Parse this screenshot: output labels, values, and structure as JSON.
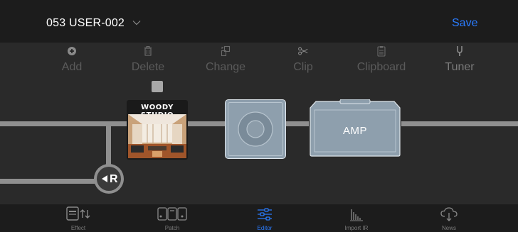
{
  "header": {
    "patch_name": "053 USER-002",
    "save_label": "Save",
    "dropdown_icon": "chevron-down-icon"
  },
  "toolbar": {
    "items": [
      {
        "label": "Add",
        "icon": "add-icon"
      },
      {
        "label": "Delete",
        "icon": "trash-icon"
      },
      {
        "label": "Change",
        "icon": "change-icon"
      },
      {
        "label": "Clip",
        "icon": "scissors-icon"
      },
      {
        "label": "Clipboard",
        "icon": "clipboard-icon"
      },
      {
        "label": "Tuner",
        "icon": "tuning-fork-icon"
      }
    ]
  },
  "chain": {
    "effect_block_title": "WOODY STUDIO",
    "amp_label": "AMP",
    "return_letter": "R"
  },
  "tabbar": {
    "active": "Editor",
    "tabs": [
      {
        "label": "Effect",
        "icon": "effect-icon"
      },
      {
        "label": "Patch",
        "icon": "patch-icon"
      },
      {
        "label": "Editor",
        "icon": "sliders-icon"
      },
      {
        "label": "Import IR",
        "icon": "import-ir-icon"
      },
      {
        "label": "News",
        "icon": "cloud-download-icon"
      }
    ]
  },
  "colors": {
    "accent": "#2a7cff",
    "background": "#2a2a2a",
    "bar": "#1c1c1c",
    "cable": "#8f8f8f"
  }
}
